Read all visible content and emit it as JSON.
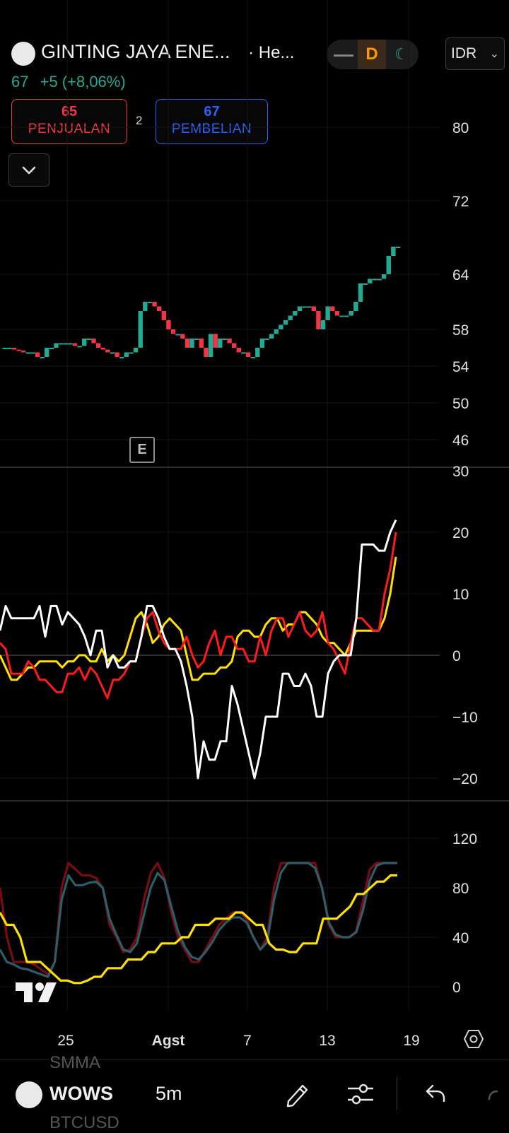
{
  "header": {
    "symbol_name": "GINTING JAYA ENE...",
    "exchange_suffix": "· He...",
    "last_price": "67",
    "change": "+5 (+8,06%)",
    "session_pill": {
      "left": "—",
      "active": "D",
      "right": "☾"
    },
    "currency": "IDR",
    "currency_chevron": "⌄"
  },
  "trade": {
    "sell_price": "65",
    "sell_label": "PENJUALAN",
    "spread": "2",
    "buy_price": "67",
    "buy_label": "PEMBELIAN"
  },
  "price_axis": [
    "80",
    "72",
    "64",
    "58",
    "54",
    "50",
    "46"
  ],
  "earnings_marker": "E",
  "osc1_axis": [
    "30",
    "20",
    "10",
    "0",
    "−10",
    "−20"
  ],
  "osc2_axis": [
    "120",
    "80",
    "40",
    "0"
  ],
  "time_axis": [
    "25",
    "Agst",
    "7",
    "13",
    "19"
  ],
  "bottom": {
    "ghost_top": "SMMA",
    "symbol": "WOWS",
    "interval": "5m",
    "ghost_bottom": "BTCUSD"
  },
  "colors": {
    "up": "#22ab94",
    "down": "#f23645",
    "white_line": "#ffffff",
    "red_line": "#ff1a1a",
    "yellow_line": "#ffe000",
    "dark_red_line": "#7a0b12",
    "teal_line": "#2c5e6a"
  },
  "chart_data": [
    {
      "type": "candlestick",
      "series_price_path": [
        56,
        56,
        56,
        55.8,
        55.7,
        55.5,
        55.5,
        55.5,
        55,
        55,
        56,
        56,
        56.5,
        56.5,
        56.5,
        56.5,
        56.2,
        56.2,
        57,
        57,
        56.5,
        56,
        55.8,
        55.5,
        55.5,
        55,
        55,
        55.5,
        55.5,
        56,
        60,
        61,
        61,
        60.5,
        60,
        59,
        58,
        57.5,
        57.5,
        57,
        56,
        57,
        57,
        56,
        55,
        57.5,
        56,
        57,
        57,
        56.5,
        56,
        55.5,
        55.5,
        55,
        55,
        56,
        57,
        57,
        57.5,
        58,
        58.5,
        59,
        59.5,
        60,
        60.5,
        60.5,
        60.5,
        60,
        58,
        59,
        60.5,
        60,
        59.5,
        59.5,
        59.5,
        60,
        61,
        63,
        63,
        63.5,
        63.5,
        63.5,
        64,
        66,
        67,
        67
      ],
      "ylim": [
        44,
        82
      ]
    },
    {
      "type": "line",
      "ylim": [
        -22,
        30
      ],
      "series": [
        {
          "values": [
            4,
            8,
            6,
            6,
            6,
            6,
            6,
            8,
            3,
            8,
            8,
            5,
            7,
            6,
            5,
            3,
            0,
            4,
            4,
            -2,
            0,
            -2,
            -2,
            -1,
            -1,
            3,
            8,
            8,
            6,
            3,
            1,
            1,
            -1,
            -5,
            -10,
            -20,
            -14,
            -17,
            -17,
            -14,
            -14,
            -5,
            -8,
            -12,
            -16,
            -20,
            -16,
            -10,
            -10,
            -10,
            -3,
            -3,
            -5,
            -5,
            -3,
            -5,
            -10,
            -10,
            -3,
            -1,
            0,
            0,
            0,
            6,
            18,
            18,
            18,
            17,
            17,
            20,
            22
          ]
        },
        {
          "values": [
            2,
            1,
            -3,
            -3,
            -3,
            -1,
            -2,
            -4,
            -4,
            -5,
            -6,
            -6,
            -3,
            -3,
            -2,
            -4,
            -2,
            -3,
            -5,
            -7,
            -4,
            -4,
            -3,
            -1,
            -1,
            3,
            6,
            7,
            4,
            2,
            1,
            1,
            1,
            3,
            0,
            -2,
            -1,
            2,
            4,
            0,
            3,
            3,
            1,
            1,
            -1,
            -1,
            3,
            0,
            4,
            6,
            6,
            3,
            5,
            7,
            4,
            3,
            4,
            7,
            2,
            1,
            -1,
            -3,
            2,
            6,
            6,
            5,
            4,
            4,
            10,
            14,
            20
          ]
        },
        {
          "values": [
            0,
            -2,
            -4,
            -4,
            -3,
            -2,
            -2,
            -1,
            -1,
            -1,
            -1,
            -2,
            -1,
            -1,
            0,
            0,
            -1,
            -1,
            1,
            -1,
            0,
            -1,
            0,
            3,
            6,
            7,
            5,
            2,
            3,
            5,
            6,
            5,
            4,
            0,
            -4,
            -4,
            -3,
            -3,
            -3,
            -2,
            -2,
            -1,
            3,
            4,
            4,
            3,
            3,
            5,
            6,
            6,
            4,
            5,
            5,
            7,
            7,
            6,
            5,
            3,
            2,
            2,
            1,
            0,
            2,
            4,
            4,
            4,
            4,
            4,
            6,
            10,
            16
          ]
        }
      ]
    },
    {
      "type": "line",
      "ylim": [
        -5,
        135
      ],
      "series": [
        {
          "values": [
            80,
            40,
            20,
            20,
            20,
            18,
            14,
            10,
            20,
            80,
            100,
            95,
            90,
            90,
            88,
            80,
            50,
            40,
            28,
            30,
            40,
            70,
            92,
            100,
            88,
            60,
            40,
            30,
            20,
            20,
            30,
            40,
            50,
            55,
            60,
            60,
            55,
            40,
            30,
            40,
            80,
            100,
            100,
            100,
            100,
            100,
            100,
            80,
            50,
            40,
            40,
            40,
            45,
            70,
            95,
            100,
            100,
            100,
            100
          ]
        },
        {
          "values": [
            30,
            20,
            18,
            15,
            14,
            12,
            10,
            8,
            20,
            70,
            90,
            82,
            82,
            84,
            85,
            80,
            55,
            42,
            30,
            28,
            35,
            58,
            80,
            92,
            86,
            65,
            45,
            32,
            24,
            22,
            28,
            36,
            46,
            52,
            56,
            56,
            52,
            40,
            30,
            36,
            70,
            92,
            100,
            100,
            100,
            100,
            96,
            80,
            52,
            42,
            40,
            40,
            44,
            62,
            86,
            98,
            100,
            100,
            100
          ]
        },
        {
          "values": [
            60,
            50,
            50,
            40,
            20,
            20,
            20,
            15,
            10,
            5,
            5,
            3,
            3,
            5,
            8,
            8,
            15,
            15,
            15,
            22,
            22,
            22,
            28,
            28,
            35,
            35,
            35,
            40,
            40,
            50,
            50,
            50,
            55,
            55,
            55,
            60,
            60,
            55,
            50,
            50,
            35,
            30,
            30,
            28,
            28,
            35,
            35,
            35,
            55,
            55,
            55,
            60,
            65,
            75,
            75,
            80,
            85,
            85,
            90,
            90
          ]
        }
      ]
    }
  ]
}
